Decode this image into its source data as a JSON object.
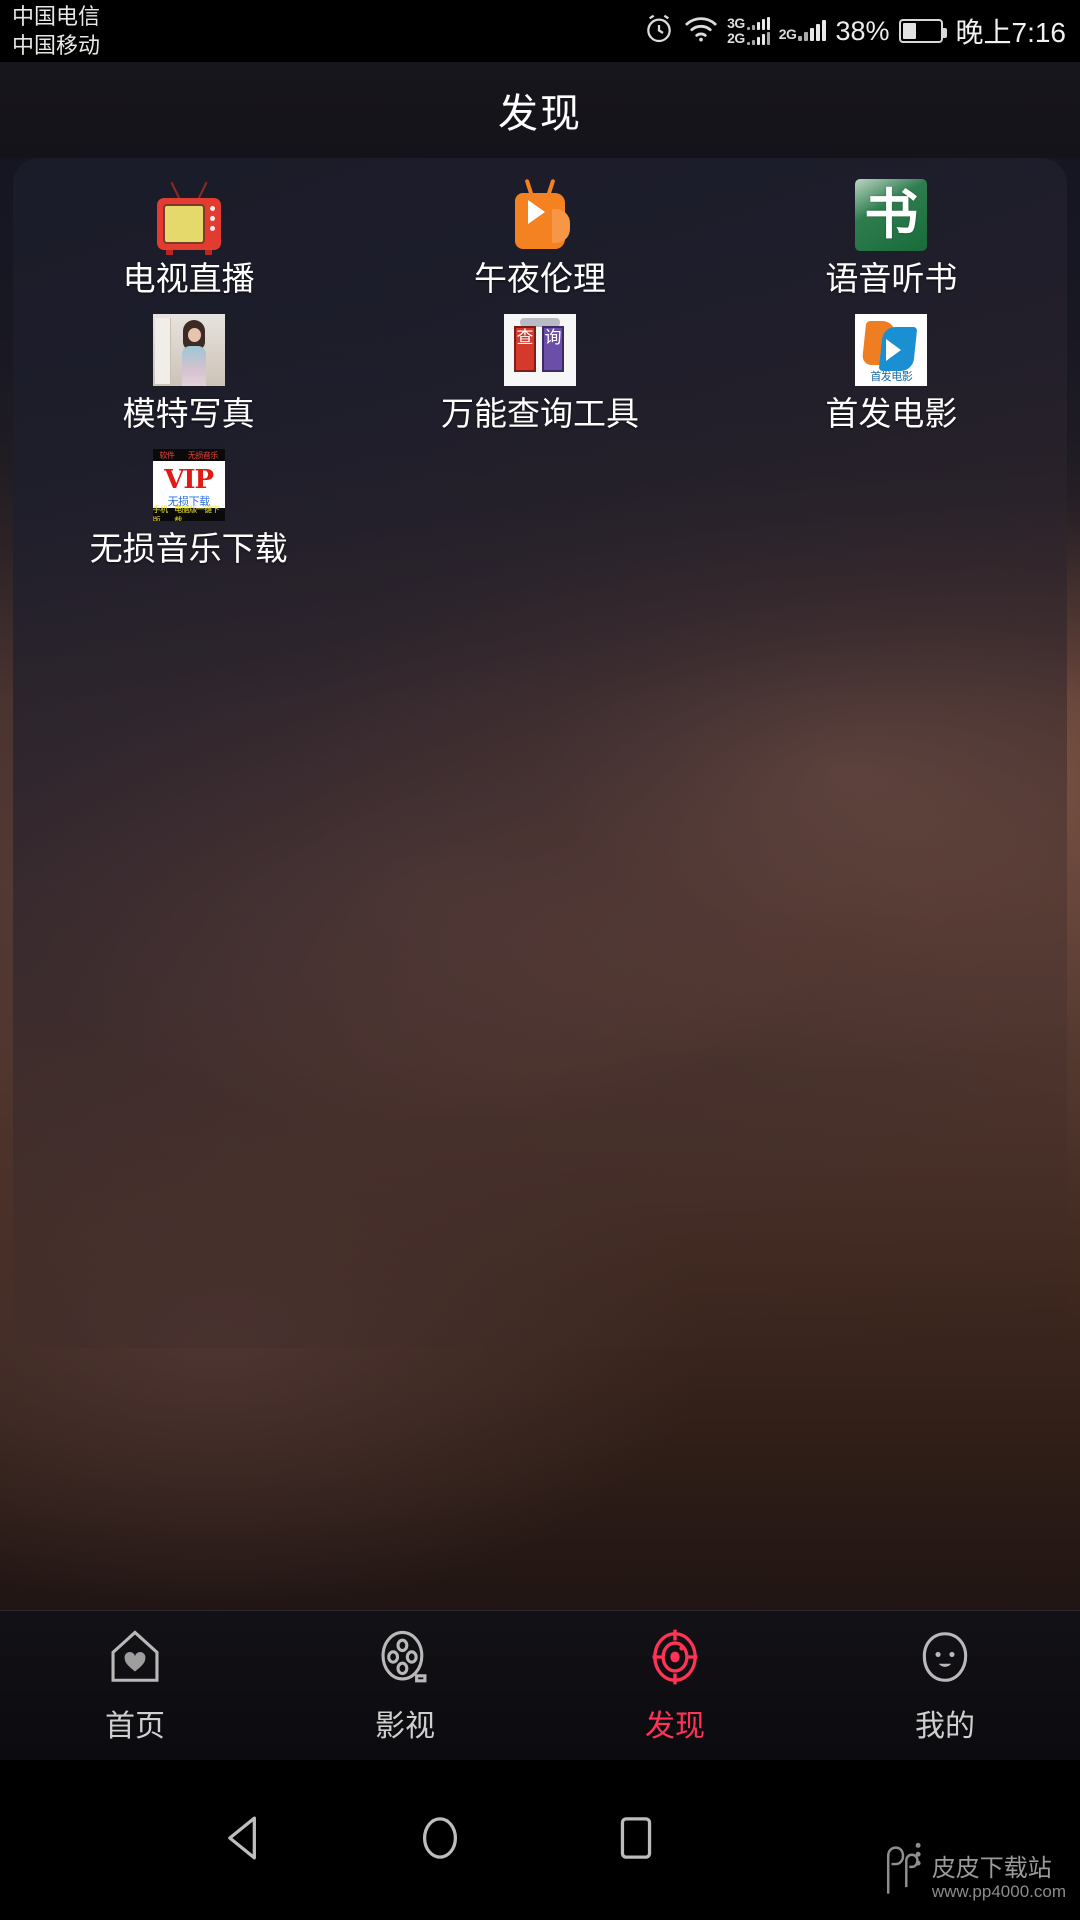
{
  "status_bar": {
    "carrier_1": "中国电信",
    "carrier_2": "中国移动",
    "alarm_icon": "alarm-clock-icon",
    "wifi_icon": "wifi-icon",
    "sim1_network": "3G",
    "sim1_network_secondary": "2G",
    "sim2_network": "2G",
    "battery_percent": "38%",
    "clock": "晚上7:16"
  },
  "header": {
    "title": "发现"
  },
  "apps": [
    {
      "label": "电视直播",
      "icon": "tv-icon"
    },
    {
      "label": "午夜伦理",
      "icon": "play-button-icon"
    },
    {
      "label": "语音听书",
      "icon": "audiobook-icon",
      "icon_char": "书"
    },
    {
      "label": "模特写真",
      "icon": "model-photo-icon"
    },
    {
      "label": "万能查询工具",
      "icon": "query-tool-icon",
      "icon_char_1": "查",
      "icon_char_2": "询"
    },
    {
      "label": "首发电影",
      "icon": "first-release-movie-icon",
      "icon_caption": "首发电影"
    },
    {
      "label": "无损音乐下载",
      "icon": "vip-music-icon",
      "vip_text": "VIP",
      "vip_sub": "无损下载",
      "vip_top_left": "软件",
      "vip_top_right": "无损音乐",
      "vip_bottom_left": "手机版",
      "vip_bottom_right": "电脑版一键下载"
    }
  ],
  "tabs": [
    {
      "label": "首页",
      "icon": "home-heart-icon",
      "active": false
    },
    {
      "label": "影视",
      "icon": "film-reel-icon",
      "active": false
    },
    {
      "label": "发现",
      "icon": "radar-target-icon",
      "active": true
    },
    {
      "label": "我的",
      "icon": "profile-face-icon",
      "active": false
    }
  ],
  "nav_bar": {
    "back": "back-triangle-icon",
    "home": "home-circle-icon",
    "recent": "recent-square-icon"
  },
  "watermark": {
    "logo": "pp-logo-icon",
    "name": "皮皮下载站",
    "url": "www.pp4000.com"
  },
  "colors": {
    "accent": "#ff3355",
    "tab_inactive": "#cfcfcf",
    "title_text": "#ffffff"
  }
}
